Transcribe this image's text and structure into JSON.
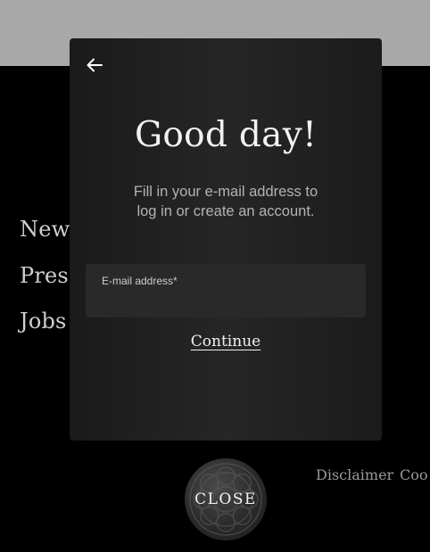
{
  "footer": {
    "links": [
      "News",
      "Press",
      "Jobs"
    ],
    "legal_links": [
      "Disclaimer",
      "Coo"
    ]
  },
  "modal": {
    "back_icon": "arrow-left-icon",
    "title": "Good day!",
    "subtitle": "Fill in your e-mail address to log in or create an account.",
    "email_label": "E-mail address*",
    "email_value": "",
    "continue_label": "Continue"
  },
  "close_button": {
    "label": "CLOSE"
  },
  "colors": {
    "top_band": "#a8a8a8",
    "background": "#000000",
    "modal": "#222222",
    "field": "#292929"
  }
}
